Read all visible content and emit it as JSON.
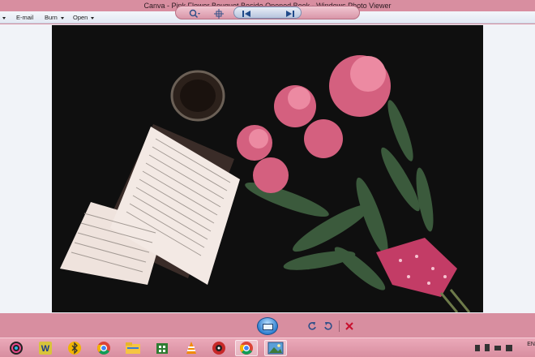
{
  "window": {
    "title": "Canva - Pink Flower Bouquet Beside Opened Book - Windows Photo Viewer"
  },
  "menubar": {
    "items": [
      {
        "label": "E-mail",
        "icon": "email-icon"
      },
      {
        "label": "Burn",
        "icon": "burn-icon"
      },
      {
        "label": "Open",
        "icon": "open-icon"
      }
    ]
  },
  "controls": {
    "zoom": "zoom-icon",
    "actual_size": "actual-size-icon",
    "previous": "previous-icon",
    "slideshow": "slideshow-icon",
    "next": "next-icon",
    "rotate_ccw": "rotate-counterclockwise-icon",
    "rotate_cw": "rotate-clockwise-icon",
    "delete": "delete-icon"
  },
  "taskbar": {
    "apps": [
      "photos-app-icon",
      "word-icon",
      "bluetooth-icon",
      "chrome-icon",
      "file-explorer-icon",
      "store-icon",
      "vlc-icon",
      "game-icon",
      "chrome-icon",
      "photo-viewer-icon"
    ],
    "tray_lang": "EN"
  },
  "colors": {
    "accent": "#d88ea0",
    "viewer_bg": "#f1f3f8",
    "photo_bg": "#0f0f0f"
  }
}
